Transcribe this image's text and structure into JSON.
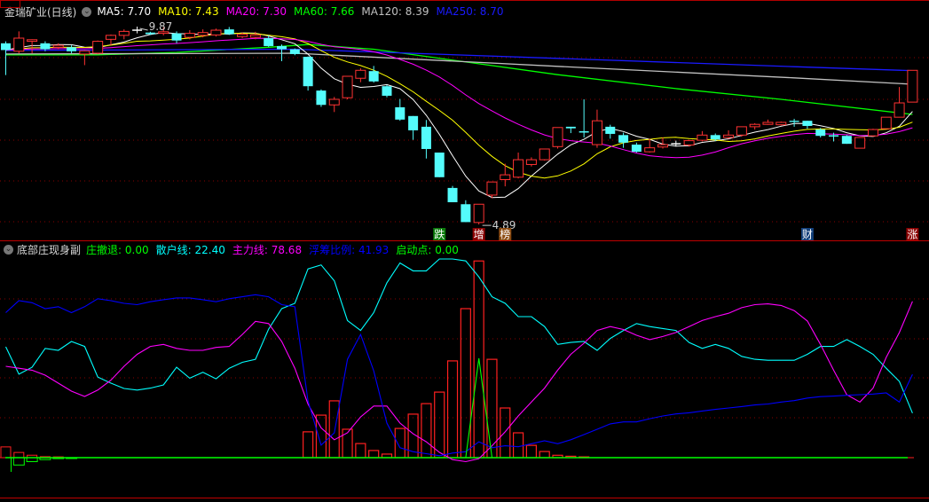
{
  "main_panel": {
    "stock_title": "金瑞矿业(日线)",
    "ma_legend": [
      {
        "label": "MA5",
        "value": "7.70",
        "color": "#ffffff"
      },
      {
        "label": "MA10",
        "value": "7.43",
        "color": "#ffff00"
      },
      {
        "label": "MA20",
        "value": "7.30",
        "color": "#ff00ff"
      },
      {
        "label": "MA60",
        "value": "7.66",
        "color": "#00ff00"
      },
      {
        "label": "MA120",
        "value": "8.39",
        "color": "#c0c0c0"
      },
      {
        "label": "MA250",
        "value": "8.70",
        "color": "#1a1aff"
      }
    ],
    "high_label": "9.87",
    "low_label": "4.89",
    "signals": [
      {
        "text": "跌",
        "index": 33,
        "bg": "#0a7a0a"
      },
      {
        "text": "增",
        "index": 36,
        "bg": "#8b0000"
      },
      {
        "text": "榜",
        "index": 38,
        "bg": "#8b4a10"
      },
      {
        "text": "财",
        "index": 61,
        "bg": "#123f7a"
      },
      {
        "text": "涨",
        "index": 69,
        "bg": "#8b0000"
      }
    ]
  },
  "indicator_panel": {
    "title": "底部庄现身副",
    "legend": [
      {
        "label": "庄撤退",
        "value": "0.00",
        "color": "#00ff00"
      },
      {
        "label": "散户线",
        "value": "22.40",
        "color": "#00ffff"
      },
      {
        "label": "主力线",
        "value": "78.68",
        "color": "#ff00ff"
      },
      {
        "label": "浮筹比例",
        "value": "41.93",
        "color": "#0000ff"
      },
      {
        "label": "启动点",
        "value": "0.00",
        "color": "#00ff00"
      }
    ]
  },
  "chart_data": [
    {
      "type": "candlestick",
      "title": "金瑞矿业(日线)",
      "price_range": [
        4.89,
        9.87
      ],
      "candles_ohlc": [
        [
          9.45,
          9.5,
          8.65,
          9.28
        ],
        [
          9.25,
          9.75,
          9.2,
          9.58
        ],
        [
          9.5,
          9.55,
          9.2,
          9.54
        ],
        [
          9.45,
          9.5,
          9.25,
          9.3
        ],
        [
          9.35,
          9.45,
          9.3,
          9.4
        ],
        [
          9.35,
          9.4,
          9.2,
          9.25
        ],
        [
          9.18,
          9.28,
          8.9,
          9.26
        ],
        [
          9.2,
          9.52,
          9.18,
          9.5
        ],
        [
          9.55,
          9.67,
          9.4,
          9.65
        ],
        [
          9.65,
          9.8,
          9.55,
          9.75
        ],
        [
          9.78,
          9.87,
          9.7,
          9.78
        ],
        [
          9.72,
          9.74,
          9.66,
          9.68
        ],
        [
          9.7,
          9.85,
          9.65,
          9.74
        ],
        [
          9.7,
          9.75,
          9.45,
          9.52
        ],
        [
          9.6,
          9.78,
          9.55,
          9.7
        ],
        [
          9.65,
          9.8,
          9.6,
          9.72
        ],
        [
          9.66,
          9.82,
          9.62,
          9.78
        ],
        [
          9.8,
          9.86,
          9.66,
          9.68
        ],
        [
          9.62,
          9.72,
          9.58,
          9.68
        ],
        [
          9.6,
          9.74,
          9.55,
          9.66
        ],
        [
          9.58,
          9.65,
          9.36,
          9.38
        ],
        [
          9.38,
          9.42,
          9.0,
          9.3
        ],
        [
          9.3,
          9.32,
          9.15,
          9.18
        ],
        [
          9.11,
          9.12,
          8.26,
          8.37
        ],
        [
          8.26,
          8.29,
          7.85,
          7.9
        ],
        [
          7.9,
          8.1,
          7.72,
          8.04
        ],
        [
          8.08,
          8.63,
          8.04,
          8.62
        ],
        [
          8.57,
          8.82,
          8.47,
          8.77
        ],
        [
          8.75,
          8.88,
          8.46,
          8.49
        ],
        [
          8.37,
          8.4,
          8.09,
          8.13
        ],
        [
          7.84,
          8.05,
          7.5,
          7.53
        ],
        [
          7.62,
          7.62,
          7.02,
          7.26
        ],
        [
          7.35,
          7.52,
          6.55,
          6.79
        ],
        [
          6.7,
          6.7,
          6.08,
          6.08
        ],
        [
          5.81,
          5.86,
          5.45,
          5.45
        ],
        [
          5.4,
          5.5,
          4.95,
          4.95
        ],
        [
          4.94,
          5.4,
          4.89,
          5.4
        ],
        [
          5.63,
          5.96,
          5.55,
          5.96
        ],
        [
          6.02,
          6.42,
          5.85,
          6.14
        ],
        [
          6.08,
          6.7,
          6.05,
          6.52
        ],
        [
          6.4,
          6.58,
          6.35,
          6.52
        ],
        [
          6.52,
          6.8,
          6.5,
          6.79
        ],
        [
          6.85,
          7.33,
          6.8,
          7.33
        ],
        [
          7.35,
          7.35,
          7.19,
          7.31
        ],
        [
          7.24,
          8.04,
          7.08,
          7.22
        ],
        [
          6.9,
          7.78,
          6.82,
          7.5
        ],
        [
          7.35,
          7.4,
          7.05,
          7.17
        ],
        [
          7.14,
          7.2,
          6.82,
          6.95
        ],
        [
          6.9,
          6.95,
          6.7,
          6.72
        ],
        [
          6.72,
          7.05,
          6.7,
          6.82
        ],
        [
          6.84,
          7.08,
          6.8,
          6.9
        ],
        [
          6.92,
          7.0,
          6.85,
          6.92
        ],
        [
          6.89,
          7.02,
          6.85,
          7.0
        ],
        [
          7.01,
          7.24,
          6.98,
          7.14
        ],
        [
          7.14,
          7.18,
          6.99,
          7.03
        ],
        [
          7.08,
          7.26,
          7.05,
          7.14
        ],
        [
          7.14,
          7.35,
          7.1,
          7.35
        ],
        [
          7.35,
          7.44,
          7.28,
          7.41
        ],
        [
          7.41,
          7.53,
          7.4,
          7.46
        ],
        [
          7.4,
          7.48,
          7.38,
          7.46
        ],
        [
          7.5,
          7.55,
          7.35,
          7.47
        ],
        [
          7.5,
          7.5,
          7.3,
          7.37
        ],
        [
          7.28,
          7.32,
          7.08,
          7.12
        ],
        [
          7.14,
          7.2,
          6.98,
          7.12
        ],
        [
          7.12,
          7.14,
          6.92,
          6.92
        ],
        [
          6.81,
          7.08,
          6.81,
          7.08
        ],
        [
          7.12,
          7.3,
          7.1,
          7.28
        ],
        [
          7.3,
          7.59,
          7.3,
          7.59
        ],
        [
          7.59,
          8.35,
          7.59,
          7.95
        ],
        [
          7.97,
          8.77,
          7.97,
          8.77
        ]
      ],
      "white_cross_indices": [
        10,
        51
      ],
      "ma_periods": [
        5,
        10,
        20
      ],
      "long_ma_knots": {
        "MA60": [
          [
            0,
            9.16
          ],
          [
            7,
            9.16
          ],
          [
            13,
            9.22
          ],
          [
            20,
            9.35
          ],
          [
            23,
            9.42
          ],
          [
            28,
            9.3
          ],
          [
            42,
            8.66
          ],
          [
            51,
            8.31
          ],
          [
            59,
            8.04
          ],
          [
            69,
            7.66
          ]
        ],
        "MA120": [
          [
            0,
            9.18
          ],
          [
            22,
            9.2
          ],
          [
            42,
            8.87
          ],
          [
            60,
            8.58
          ],
          [
            69,
            8.42
          ]
        ],
        "MA250": [
          [
            0,
            9.27
          ],
          [
            22,
            9.3
          ],
          [
            42,
            9.07
          ],
          [
            60,
            8.86
          ],
          [
            69,
            8.76
          ]
        ]
      }
    },
    {
      "type": "line",
      "title": "底部庄现身副",
      "ylim": [
        0,
        100
      ],
      "series": [
        {
          "name": "散户线",
          "color": "#00ffff",
          "values": [
            55.8,
            42,
            45.5,
            55,
            54,
            58.5,
            56,
            40.6,
            37.5,
            34.8,
            34,
            35,
            36.6,
            45.5,
            40,
            43,
            39.7,
            45,
            48,
            49.5,
            64.7,
            75,
            77.7,
            95,
            97,
            89,
            69,
            64,
            73,
            88,
            98,
            94,
            94,
            100,
            100,
            99,
            91,
            81,
            77.7,
            71,
            71,
            66,
            57,
            58,
            58.5,
            54,
            60,
            64,
            67.5,
            66,
            65,
            64,
            58,
            55,
            57,
            55,
            51,
            49.5,
            49,
            49,
            49,
            52,
            56,
            56,
            59.4,
            56,
            52,
            45,
            38.4,
            22.4
          ]
        },
        {
          "name": "主力线",
          "color": "#ff00ff",
          "values": [
            46,
            45,
            44,
            41.5,
            37.5,
            33.5,
            30.8,
            34,
            39,
            46,
            52,
            56,
            57,
            55,
            54,
            54,
            55.5,
            56,
            62,
            68.6,
            67.5,
            58.5,
            45,
            27,
            15,
            9,
            12.5,
            20.5,
            26,
            26,
            17.4,
            12,
            8,
            2.7,
            -1,
            -2,
            -0.5,
            6,
            13,
            21,
            28,
            35,
            44,
            52,
            57.6,
            64,
            66,
            64.5,
            61.6,
            59.4,
            61,
            63,
            66,
            69,
            71,
            72.7,
            75.5,
            77,
            77.4,
            76.6,
            74,
            68.8,
            57,
            44,
            31.7,
            28,
            35,
            50.5,
            63,
            78.68
          ]
        },
        {
          "name": "浮筹比例",
          "color": "#0000ff",
          "values": [
            73,
            79,
            78,
            75,
            76,
            73,
            76,
            80,
            79,
            77.7,
            77,
            78.5,
            79.5,
            80.4,
            80.4,
            79.5,
            78.5,
            80,
            81,
            82,
            81,
            77,
            76,
            28.6,
            6.3,
            12.5,
            49.5,
            62,
            43.7,
            17.4,
            5,
            3,
            2,
            1,
            2.3,
            3,
            8,
            5,
            6,
            5.5,
            7,
            8.5,
            7,
            9,
            11.6,
            14.3,
            17,
            18,
            18,
            19.6,
            21,
            22,
            22.6,
            23.5,
            24.3,
            25,
            25.7,
            26.5,
            27,
            28,
            28.7,
            30,
            30.7,
            31,
            31.4,
            31.7,
            32,
            32.6,
            28,
            41.93
          ]
        },
        {
          "name": "启动点",
          "color": "#00ff00",
          "points": [
            [
              35,
              0
            ],
            [
              36,
              50
            ],
            [
              37,
              0
            ]
          ]
        }
      ],
      "bars_red": [
        [
          0,
          5.4
        ],
        [
          1,
          2.6
        ],
        [
          2,
          1.2
        ],
        [
          3,
          0.5
        ],
        [
          4,
          0.4
        ],
        [
          23,
          13
        ],
        [
          24,
          21.4
        ],
        [
          25,
          28.6
        ],
        [
          26,
          14.3
        ],
        [
          27,
          7.1
        ],
        [
          28,
          3.6
        ],
        [
          29,
          1.8
        ],
        [
          30,
          14.7
        ],
        [
          31,
          21.9
        ],
        [
          32,
          27.2
        ],
        [
          33,
          33
        ],
        [
          34,
          48.7
        ],
        [
          35,
          75
        ],
        [
          36,
          99
        ],
        [
          37,
          49.5
        ],
        [
          38,
          25
        ],
        [
          39,
          12.5
        ],
        [
          40,
          6.2
        ],
        [
          41,
          3.1
        ],
        [
          42,
          1.2
        ],
        [
          43,
          0.7
        ],
        [
          44,
          0.4
        ]
      ],
      "bars_green_庄撤退": [
        [
          1,
          -3.7
        ],
        [
          2,
          -2
        ],
        [
          3,
          -1
        ],
        [
          4,
          -0.5
        ],
        [
          5,
          -0.3
        ]
      ]
    }
  ]
}
